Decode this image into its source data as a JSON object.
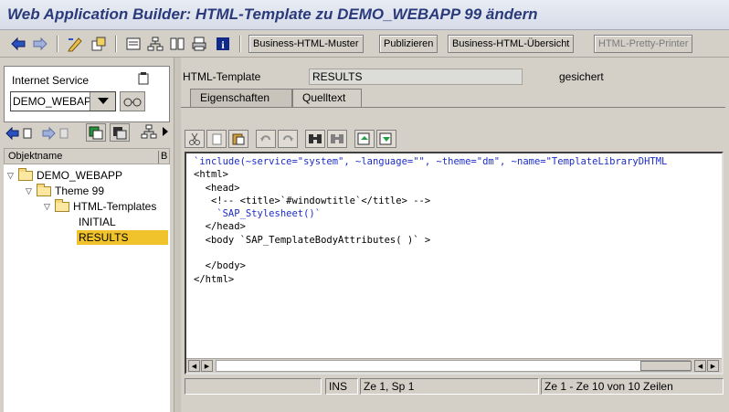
{
  "window": {
    "title": "Web Application Builder: HTML-Template zu DEMO_WEBAPP 99 ändern"
  },
  "toolbar": {
    "buttons": [
      "Business-HTML-Muster",
      "Publizieren",
      "Business-HTML-Übersicht",
      "HTML-Pretty-Printer"
    ]
  },
  "left": {
    "service_label": "Internet Service",
    "service_value": "DEMO_WEBAPP",
    "tree_header": {
      "col1": "Objektname",
      "col2": "B"
    },
    "tree": [
      "DEMO_WEBAPP",
      "Theme 99",
      "HTML-Templates",
      "INITIAL",
      "RESULTS"
    ]
  },
  "main": {
    "template_label": "HTML-Template",
    "template_value": "RESULTS",
    "status": "gesichert",
    "tabs": [
      "Eigenschaften",
      "Quelltext"
    ],
    "code": [
      "`include(~service=\"system\", ~language=\"\", ~theme=\"dm\", ~name=\"TemplateLibraryDHTML",
      "<html>",
      "  <head>",
      "   <!-- <title>`#windowtitle`</title> -->",
      "    `SAP_Stylesheet()`",
      "  </head>",
      "  <body `SAP_TemplateBodyAttributes( )` >",
      "",
      "  </body>",
      "</html>"
    ],
    "statusbar": {
      "mode": "INS",
      "position": "Ze 1, Sp 1",
      "lines": "Ze 1 - Ze 10 von 10 Zeilen"
    }
  },
  "colors": {
    "title": "#2a3a7a",
    "selection": "#f0c32c",
    "code_blue": "#1c2cc8"
  }
}
